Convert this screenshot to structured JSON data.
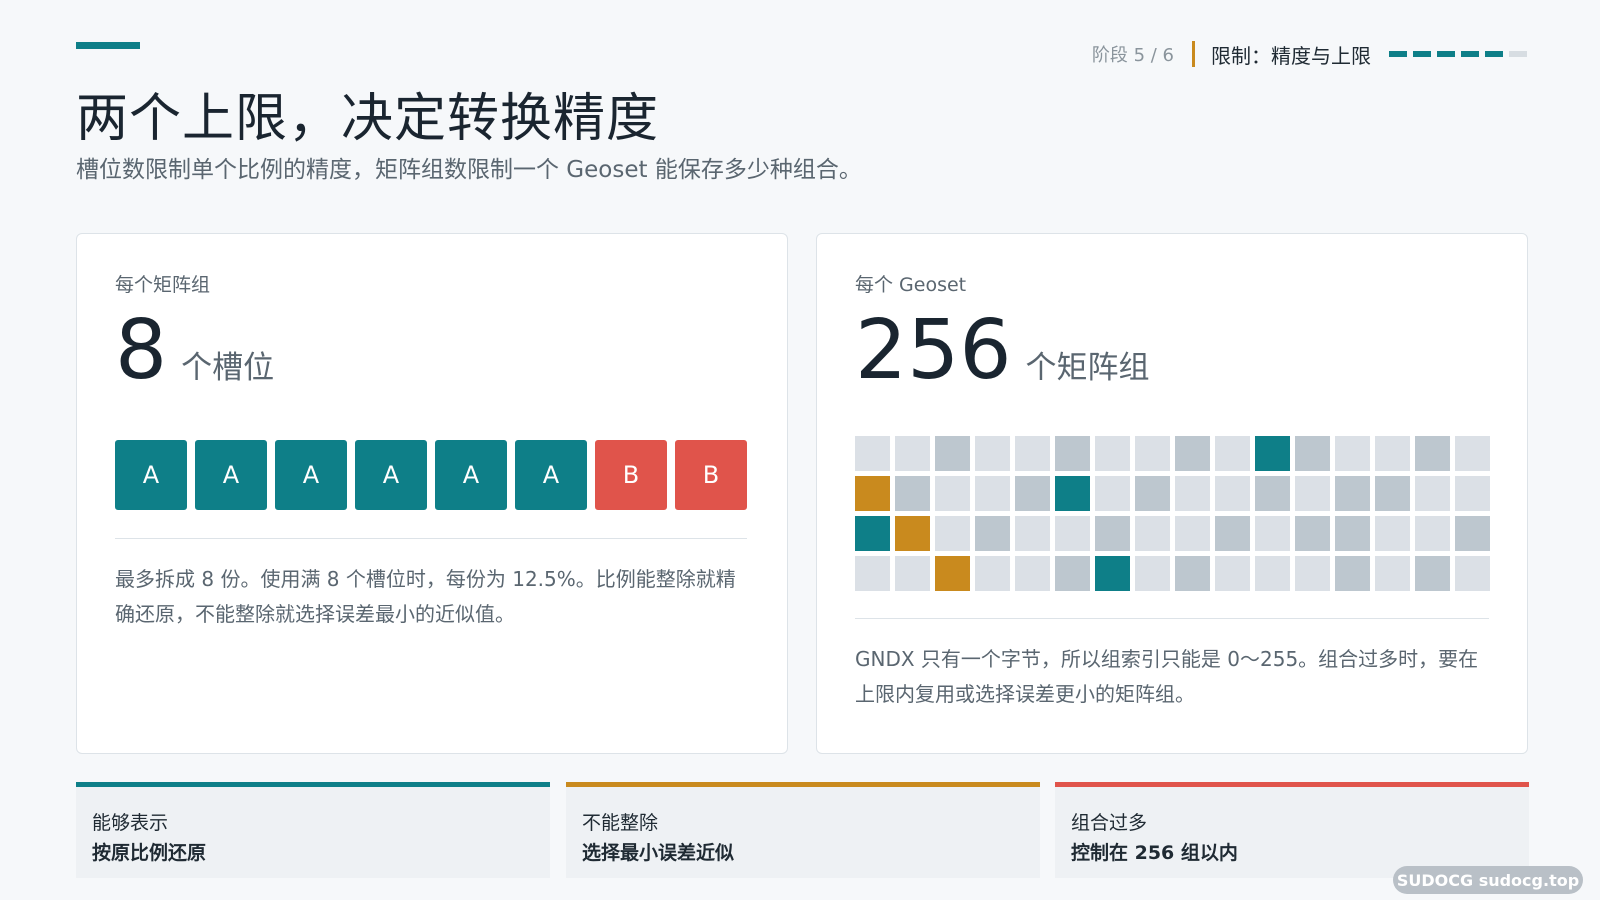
{
  "header": {
    "stage": "阶段 5 / 6",
    "topic": "限制：精度与上限",
    "progress_steps_total": 6,
    "progress_steps_done": 5,
    "title": "两个上限，决定转换精度",
    "subtitle": "槽位数限制单个比例的精度，矩阵组数限制一个 Geoset 能保存多少种组合。"
  },
  "colors": {
    "accent": "#0e7f88",
    "amber": "#c98a1e",
    "red": "#e0544b",
    "cell_light": "#dbe0e6",
    "cell_mid": "#bdc7cf"
  },
  "left_card": {
    "label": "每个矩阵组",
    "number": "8",
    "unit": "个槽位",
    "slots": [
      "A",
      "A",
      "A",
      "A",
      "A",
      "A",
      "B",
      "B"
    ],
    "description": "最多拆成 8 份。使用满 8 个槽位时，每份为 12.5%。比例能整除就精确还原，不能整除就选择误差最小的近似值。"
  },
  "right_card": {
    "label": "每个 Geoset",
    "number": "256",
    "unit": "个矩阵组",
    "grid": [
      "llmllmllmltmllml",
      "ymllmtlmllmlmmll",
      "tylmllmllmlmmllm",
      "llyllmtlmlllmlml"
    ],
    "description": "GNDX 只有一个字节，所以组索引只能是 0～255。组合过多时，要在上限内复用或选择误差更小的矩阵组。"
  },
  "bottom": [
    {
      "key": "能够表示",
      "value": "按原比例还原",
      "color": "#0e7f88"
    },
    {
      "key": "不能整除",
      "value": "选择最小误差近似",
      "color": "#c98a1e"
    },
    {
      "key": "组合过多",
      "value": "控制在 256 组以内",
      "color": "#e0544b"
    }
  ],
  "watermark": "SUDOCG sudocg.top"
}
